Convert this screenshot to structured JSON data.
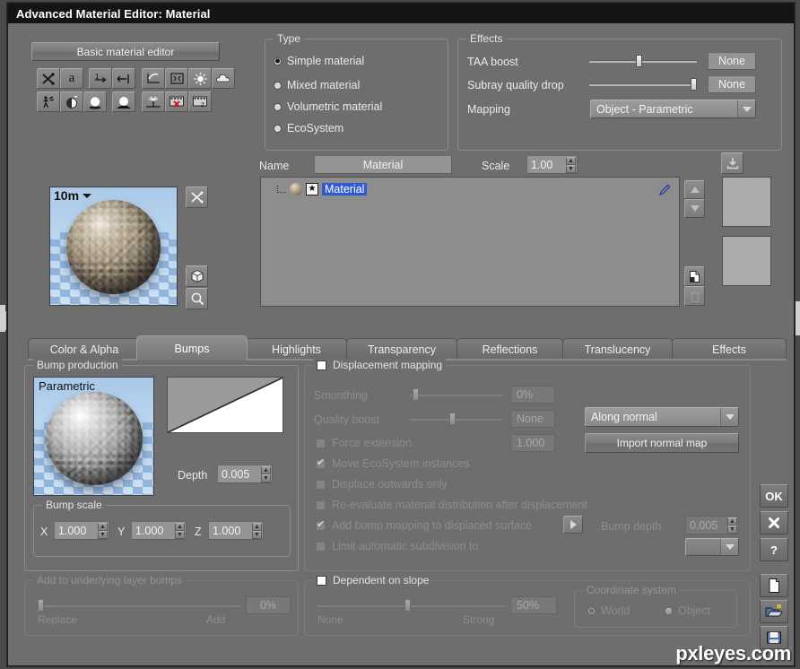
{
  "window": {
    "title": "Advanced Material Editor: Material"
  },
  "toolbar": {
    "basic_editor_button": "Basic material editor",
    "icons_row1": [
      "shuffle-icon",
      "letter-a-icon",
      "one-arrow-icon",
      "width-arrow-icon",
      "checkmark-curve-icon",
      "pinch-icon",
      "light-bulb-icon",
      "cloud-icon"
    ],
    "icons_row2": [
      "walking-person-icon",
      "half-moon-icon",
      "sphere-white-icon",
      "sphere-dark-icon",
      "tree-icon",
      "film-delete-icon",
      "film-z-icon"
    ]
  },
  "type_group": {
    "label": "Type",
    "options": [
      {
        "label": "Simple material",
        "selected": true
      },
      {
        "label": "Mixed material",
        "selected": false
      },
      {
        "label": "Volumetric material",
        "selected": false
      },
      {
        "label": "EcoSystem",
        "selected": false
      }
    ]
  },
  "effects_group": {
    "label": "Effects",
    "taa_boost": {
      "label": "TAA boost",
      "value": "None",
      "slider_pct": 46
    },
    "subray_quality_drop": {
      "label": "Subray quality drop",
      "value": "None",
      "slider_pct": 98
    },
    "mapping": {
      "label": "Mapping",
      "value": "Object - Parametric"
    }
  },
  "preview": {
    "size_label": "10m",
    "randomize_icon": "shuffle-icon",
    "shape_icon": "cube-icon",
    "zoom_icon": "magnifier-icon"
  },
  "name_row": {
    "name_label": "Name",
    "name_value": "Material",
    "scale_label": "Scale",
    "scale_value": "1.00",
    "save_icon": "save-down-icon"
  },
  "tree": {
    "node_label": "Material",
    "node_icon": "material-sphere-icon",
    "star_icon": "star-box-icon",
    "edit_icon": "pencil-icon",
    "up_icon": "arrow-up-icon",
    "down_icon": "arrow-down-icon",
    "copy_icon": "copy-page-icon",
    "delete_icon": "trash-icon"
  },
  "tabs": [
    {
      "label": "Color & Alpha",
      "active": false
    },
    {
      "label": "Bumps",
      "active": true
    },
    {
      "label": "Highlights",
      "active": false
    },
    {
      "label": "Transparency",
      "active": false
    },
    {
      "label": "Reflections",
      "active": false
    },
    {
      "label": "Translucency",
      "active": false
    },
    {
      "label": "Effects",
      "active": false
    }
  ],
  "bump_production": {
    "label": "Bump production",
    "preview_caption": "Parametric",
    "depth_label": "Depth",
    "depth_value": "0.005",
    "bump_scale": {
      "label": "Bump scale",
      "x_label": "X",
      "x_value": "1.000",
      "y_label": "Y",
      "y_value": "1.000",
      "z_label": "Z",
      "z_value": "1.000"
    }
  },
  "add_underlying": {
    "label": "Add to underlying layer bumps",
    "min_label": "Replace",
    "max_label": "Add",
    "value": "0%",
    "slider_pct": 1
  },
  "displacement": {
    "label": "Displacement mapping",
    "enabled": false,
    "smoothing": {
      "label": "Smoothing",
      "value": "0%",
      "slider_pct": 4
    },
    "quality_boost": {
      "label": "Quality boost",
      "value": "None",
      "slider_pct": 45
    },
    "force_extension": {
      "label": "Force extension",
      "checked": false,
      "value": "1.000"
    },
    "move_ecosystem": {
      "label": "Move EcoSystem instances",
      "checked": true
    },
    "displace_outwards": {
      "label": "Displace outwards only",
      "checked": false
    },
    "reevaluate": {
      "label": "Re-evaluate material distribution after displacement",
      "checked": false
    },
    "add_bump_mapping": {
      "label": "Add bump mapping to displaced surface",
      "checked": true,
      "expand_icon": "play-arrow-icon"
    },
    "limit_subdivision": {
      "label": "Limit automatic subdivision to",
      "checked": false
    },
    "direction": {
      "value": "Along normal"
    },
    "import_normal_map_button": "Import normal map",
    "bump_depth": {
      "label": "Bump depth",
      "value": "0.005"
    }
  },
  "dependent_on_slope": {
    "label": "Dependent on slope",
    "enabled": false,
    "min_label": "None",
    "max_label": "Strong",
    "value": "50%",
    "slider_pct": 48,
    "coordinate_system": {
      "label": "Coordinate system",
      "options": [
        {
          "label": "World",
          "selected": true
        },
        {
          "label": "Object",
          "selected": false
        }
      ]
    }
  },
  "right_buttons": [
    {
      "name": "ok-button",
      "label": "OK",
      "icon": ""
    },
    {
      "name": "cancel-button",
      "label": "",
      "icon": "close-x-icon"
    },
    {
      "name": "help-button",
      "label": "?",
      "icon": ""
    },
    {
      "name": "new-button",
      "label": "",
      "icon": "new-page-icon"
    },
    {
      "name": "open-button",
      "label": "",
      "icon": "open-folder-icon"
    },
    {
      "name": "save-button",
      "label": "",
      "icon": "save-disk-icon"
    }
  ],
  "watermark": {
    "text": "pxleyes.com"
  }
}
